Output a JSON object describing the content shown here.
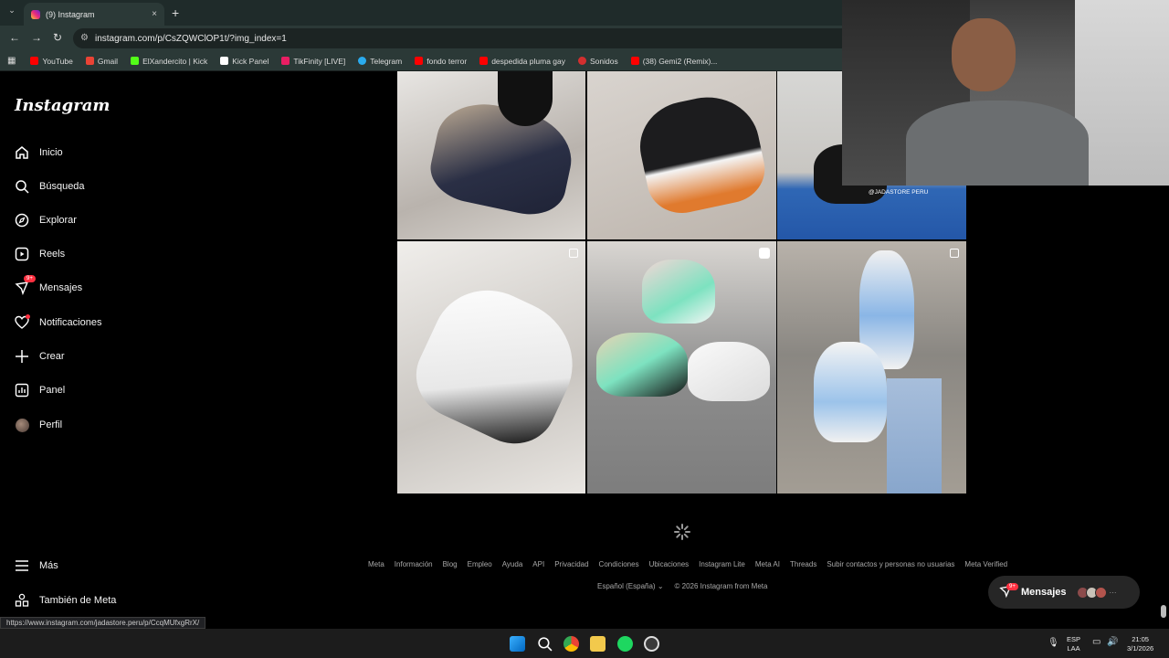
{
  "browser": {
    "tab_title": "(9) Instagram",
    "tab_close": "×",
    "new_tab": "+",
    "url": "instagram.com/p/CsZQWClOP1t/?img_index=1",
    "bookmarks": [
      {
        "label": "YouTube",
        "color": "#ff0000"
      },
      {
        "label": "Gmail",
        "color": "#ea4335"
      },
      {
        "label": "ElXandercito | Kick",
        "color": "#53fc18"
      },
      {
        "label": "Kick Panel",
        "color": "#ffffff"
      },
      {
        "label": "TikFinity [LIVE]",
        "color": "#e91e63"
      },
      {
        "label": "Telegram",
        "color": "#2aabee"
      },
      {
        "label": "fondo terror",
        "color": "#ff0000"
      },
      {
        "label": "despedida pluma gay",
        "color": "#ff0000"
      },
      {
        "label": "Sonidos",
        "color": "#d32f2f"
      },
      {
        "label": "(38) Gemi2 (Remix)...",
        "color": "#ff0000"
      }
    ],
    "status_url": "https://www.instagram.com/jadastore.peru/p/CcqMUfxgRrX/"
  },
  "sidebar": {
    "logo": "Instagram",
    "items": [
      {
        "label": "Inicio",
        "icon": "home-icon"
      },
      {
        "label": "Búsqueda",
        "icon": "search-icon"
      },
      {
        "label": "Explorar",
        "icon": "compass-icon"
      },
      {
        "label": "Reels",
        "icon": "reels-icon"
      },
      {
        "label": "Mensajes",
        "icon": "messenger-icon",
        "badge": "9+"
      },
      {
        "label": "Notificaciones",
        "icon": "heart-icon"
      },
      {
        "label": "Crear",
        "icon": "plus-icon"
      },
      {
        "label": "Panel",
        "icon": "chart-icon"
      },
      {
        "label": "Perfil",
        "icon": "avatar-icon"
      }
    ],
    "more": "Más",
    "meta": "También de Meta"
  },
  "grid": {
    "watermark": "@JADASTORE PERU"
  },
  "footer": {
    "links": [
      "Meta",
      "Información",
      "Blog",
      "Empleo",
      "Ayuda",
      "API",
      "Privacidad",
      "Condiciones",
      "Ubicaciones",
      "Instagram Lite",
      "Meta AI",
      "Threads",
      "Subir contactos y personas no usuarias",
      "Meta Verified"
    ],
    "language": "Español (España)",
    "copyright": "© 2026 Instagram from Meta"
  },
  "messages_pill": {
    "label": "Mensajes",
    "badge": "9+",
    "more": "···"
  },
  "taskbar": {
    "lang": "ESP",
    "layout": "LAA",
    "time": "21:05",
    "date": "3/1/2026"
  }
}
